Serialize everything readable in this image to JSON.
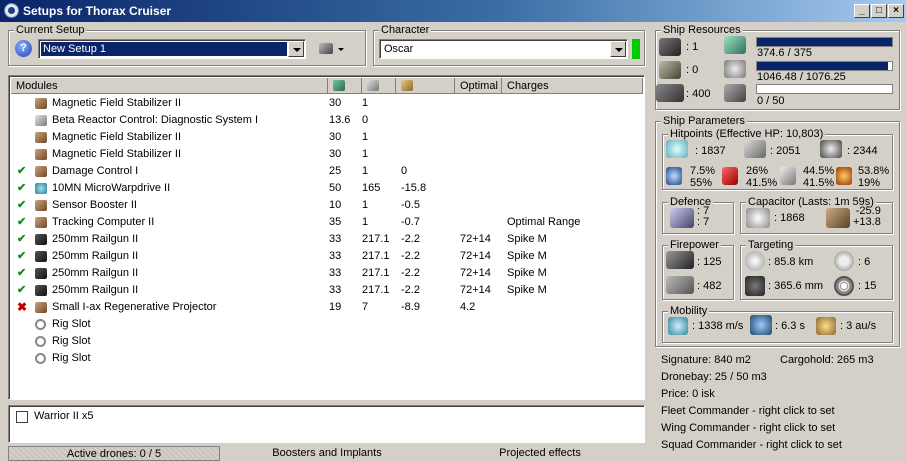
{
  "window": {
    "title": "Setups for Thorax Cruiser",
    "buttons": [
      "_",
      "□",
      "×"
    ]
  },
  "setup": {
    "label": "Current Setup",
    "value": "New Setup 1"
  },
  "character": {
    "label": "Character",
    "value": "Oscar",
    "status_color": "#00cc00"
  },
  "modules": {
    "headers": [
      "Modules",
      "",
      "",
      "",
      "Optimal",
      "Charges"
    ],
    "rows": [
      {
        "status": "",
        "icon": "mag-stab",
        "name": "Magnetic Field Stabilizer II",
        "cpu": "30",
        "pg": "1",
        "cap": "",
        "optimal": "",
        "charges": ""
      },
      {
        "status": "",
        "icon": "tech",
        "name": "Beta Reactor Control: Diagnostic System I",
        "cpu": "13.6",
        "pg": "0",
        "cap": "",
        "optimal": "",
        "charges": ""
      },
      {
        "status": "",
        "icon": "mag-stab",
        "name": "Magnetic Field Stabilizer II",
        "cpu": "30",
        "pg": "1",
        "cap": "",
        "optimal": "",
        "charges": ""
      },
      {
        "status": "",
        "icon": "mag-stab",
        "name": "Magnetic Field Stabilizer II",
        "cpu": "30",
        "pg": "1",
        "cap": "",
        "optimal": "",
        "charges": ""
      },
      {
        "status": "✔",
        "icon": "mag-stab",
        "name": "Damage Control I",
        "cpu": "25",
        "pg": "1",
        "cap": "0",
        "optimal": "",
        "charges": ""
      },
      {
        "status": "✔",
        "icon": "blue",
        "name": "10MN MicroWarpdrive II",
        "cpu": "50",
        "pg": "165",
        "cap": "-15.8",
        "optimal": "",
        "charges": ""
      },
      {
        "status": "✔",
        "icon": "mag-stab",
        "name": "Sensor Booster II",
        "cpu": "10",
        "pg": "1",
        "cap": "-0.5",
        "optimal": "",
        "charges": ""
      },
      {
        "status": "✔",
        "icon": "mag-stab",
        "name": "Tracking Computer II",
        "cpu": "35",
        "pg": "1",
        "cap": "-0.7",
        "optimal": "",
        "charges": "Optimal Range"
      },
      {
        "status": "✔",
        "icon": "gun",
        "name": "250mm Railgun II",
        "cpu": "33",
        "pg": "217.1",
        "cap": "-2.2",
        "optimal": "72+14",
        "charges": "Spike M"
      },
      {
        "status": "✔",
        "icon": "gun",
        "name": "250mm Railgun II",
        "cpu": "33",
        "pg": "217.1",
        "cap": "-2.2",
        "optimal": "72+14",
        "charges": "Spike M"
      },
      {
        "status": "✔",
        "icon": "gun",
        "name": "250mm Railgun II",
        "cpu": "33",
        "pg": "217.1",
        "cap": "-2.2",
        "optimal": "72+14",
        "charges": "Spike M"
      },
      {
        "status": "✔",
        "icon": "gun",
        "name": "250mm Railgun II",
        "cpu": "33",
        "pg": "217.1",
        "cap": "-2.2",
        "optimal": "72+14",
        "charges": "Spike M"
      },
      {
        "status": "✖",
        "icon": "mag-stab",
        "name": "Small I-ax Regenerative Projector",
        "cpu": "19",
        "pg": "7",
        "cap": "-8.9",
        "optimal": "4.2",
        "charges": ""
      },
      {
        "status": "",
        "icon": "ring",
        "name": "Rig Slot",
        "cpu": "",
        "pg": "",
        "cap": "",
        "optimal": "",
        "charges": ""
      },
      {
        "status": "",
        "icon": "ring",
        "name": "Rig Slot",
        "cpu": "",
        "pg": "",
        "cap": "",
        "optimal": "",
        "charges": ""
      },
      {
        "status": "",
        "icon": "ring",
        "name": "Rig Slot",
        "cpu": "",
        "pg": "",
        "cap": "",
        "optimal": "",
        "charges": ""
      }
    ]
  },
  "drones": {
    "item": "Warrior II x5"
  },
  "status_bar": {
    "active_drones": "Active drones: 0 / 5",
    "boosters": "Boosters and Implants",
    "projected": "Projected effects"
  },
  "resources": {
    "title": "Ship Resources",
    "hardpoints": [
      ": 1",
      ": 0",
      ": 400"
    ],
    "cpu_text": "374.6 / 375",
    "cpu_fill": 0.999,
    "pg_text": "1046.48 / 1076.25",
    "pg_fill": 0.972,
    "calib_text": "0 / 50",
    "calib_fill": 0
  },
  "params": {
    "title": "Ship Parameters",
    "hp_title": "Hitpoints (Effective HP: 10,803)",
    "shield_hp": ": 1837",
    "armor_hp": ": 2051",
    "hull_hp": ": 2344",
    "res": [
      [
        "7.5%",
        "55%"
      ],
      [
        "26%",
        "41.5%"
      ],
      [
        "44.5%",
        "41.5%"
      ],
      [
        "53.8%",
        "19%"
      ]
    ],
    "defence_title": "Defence",
    "def1": ": 7",
    "def2": ": 7",
    "cap_title": "Capacitor (Lasts: 1m 59s)",
    "cap_amount": ": 1868",
    "cap_delta1": "-25.9",
    "cap_delta2": "+13.8",
    "fire_title": "Firepower",
    "fire1": ": 125",
    "fire2": ": 482",
    "target_title": "Targeting",
    "target_range": ": 85.8 km",
    "target_count": ": 6",
    "scan_res": ": 365.6 mm",
    "sensor_str": ": 15",
    "mobility_title": "Mobility",
    "speed": ": 1338 m/s",
    "align": ": 6.3 s",
    "warp": ": 3 au/s"
  },
  "info": [
    "Signature: 840 m2",
    "Cargohold: 265 m3",
    "Dronebay: 25 / 50 m3",
    "Price: 0 isk",
    "Fleet Commander - right click to set",
    "Wing Commander - right click to set",
    "Squad Commander - right click to set"
  ]
}
